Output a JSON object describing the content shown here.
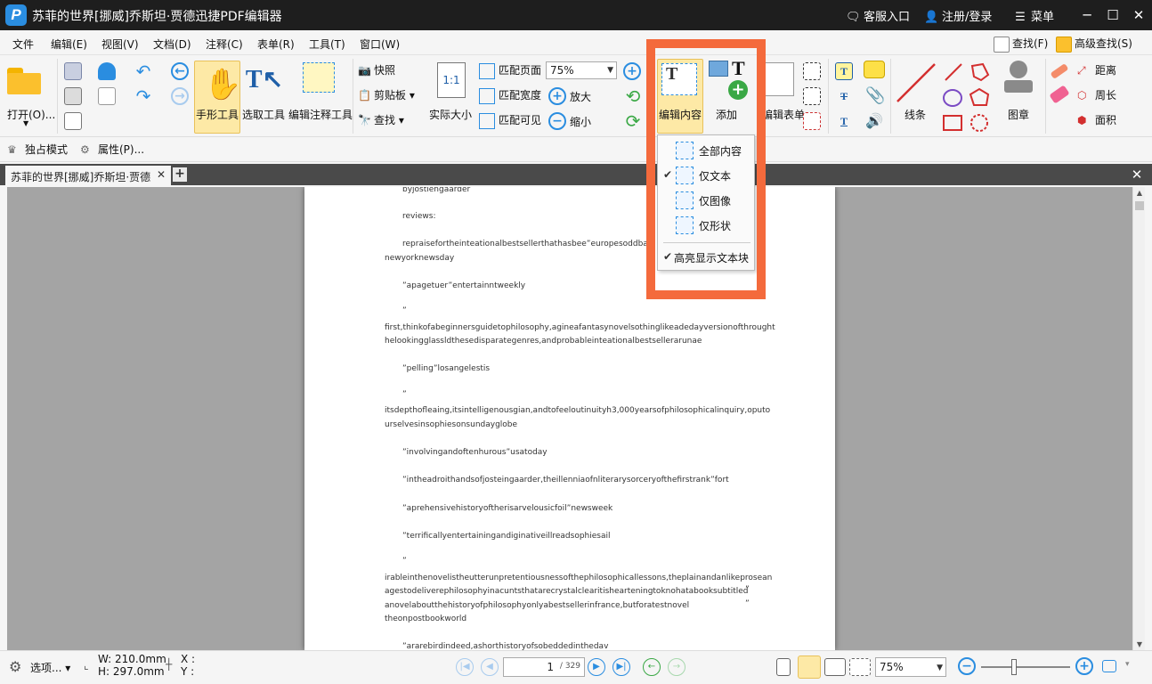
{
  "titlebar": {
    "logo": "P",
    "title": "苏菲的世界[挪威]乔斯坦·贾德迅捷PDF编辑器",
    "service": "客服入口",
    "login": "注册/登录",
    "menu": "菜单",
    "minimize": "─",
    "maximize": "☐",
    "close": "✕"
  },
  "menubar": {
    "items": [
      "文件",
      "编辑(E)",
      "视图(V)",
      "文档(D)",
      "注释(C)",
      "表单(R)",
      "工具(T)",
      "窗口(W)"
    ],
    "find": "查找(F)",
    "advanced_find": "高级查找(S)"
  },
  "ribbon": {
    "open": "打开(O)...",
    "hand_tool": "手形工具",
    "select_tool": "选取工具",
    "edit_annotation_tool": "编辑注释工具",
    "snapshot": "快照",
    "clipboard": "剪贴板",
    "find": "查找",
    "actual_size": "实际大小",
    "actual_size_icon": "1:1",
    "fit_page": "匹配页面",
    "fit_width": "匹配宽度",
    "fit_visible": "匹配可见",
    "zoom_value": "75%",
    "zoom_in": "放大",
    "zoom_out": "缩小",
    "edit_content": "编辑内容",
    "add": "添加",
    "edit_form": "编辑表单",
    "lines": "线条",
    "stamp": "图章",
    "distance": "距离",
    "perimeter": "周长",
    "area": "面积"
  },
  "modebar": {
    "exclusive_mode": "独占模式",
    "properties": "属性(P)..."
  },
  "tabs": {
    "doc_tab": "苏菲的世界[挪威]乔斯坦·贾德",
    "close": "✕",
    "new": "+",
    "close_all": "✕"
  },
  "dropdown": {
    "items": [
      {
        "label": "全部内容",
        "checked": false
      },
      {
        "label": "仅文本",
        "checked": true
      },
      {
        "label": "仅图像",
        "checked": false
      },
      {
        "label": "仅形状",
        "checked": false
      }
    ],
    "highlight_text_blocks": "高亮显示文本块",
    "check": "✔"
  },
  "page_text": [
    "byjostiengaarder",
    "reviews:",
    "repraisefortheinteationalbestsellerthathasbee”europesoddballl",
    "newyorknewsday",
    "”apagetuer”entertainntweekly",
    "”",
    "first,thinkofabeginnersguidetophilosophy,agineafantasynovelsothinglikeadedayversionofthrought",
    "helookingglassldthesedisparategenres,andprobableinteationalbestsellerarunae",
    "”pelling”losangelestis",
    "”",
    "itsdepthofleaing,itsintelligenousgian,andtofeeloutinuityh3,000yearsofphilosophicalinquiry,oputo",
    "urselvesinsophiesonsundayglobe",
    "”involvingandoftenhurous”usatoday",
    "”intheadroithandsofjosteingaarder,theillenniaofnliterarysorceryofthefirstrank”fort",
    "”aprehensivehistoryoftherisarvelousicfoil”newsweek",
    "”terrificallyentertainingandiginativeillreadsophiesail",
    "”",
    "irableinthenovelistheutterunpretentiousnessofthephilosophicallessons,theplainandanlikeprosean",
    "agestodeliverephilosophyinacuntsthatarecrystalclearitishearteningtoknohatabooksubtitled",
    "anovelaboutthehistoryofphilosophyonlyabestsellerinfrance,butforatestnovel",
    "theonpostbookworld",
    "”ararebirdindeed,ashorthistoryofsobeddedinthedav"
  ],
  "page_quotes": [
    "”",
    "”"
  ],
  "statusbar": {
    "options": "选项...",
    "width": "W: 210.0mm",
    "height": "H: 297.0mm",
    "x": "X :",
    "y": "Y :",
    "current_page": "1",
    "total_pages": "/ 329",
    "zoom_value": "75%"
  },
  "colors": {
    "titlebar": "#1e1e1e",
    "accent": "#2a8de0",
    "active_tool": "#fde9a6",
    "callout": "#f46a3c",
    "doc_background": "#a4a4a4"
  }
}
